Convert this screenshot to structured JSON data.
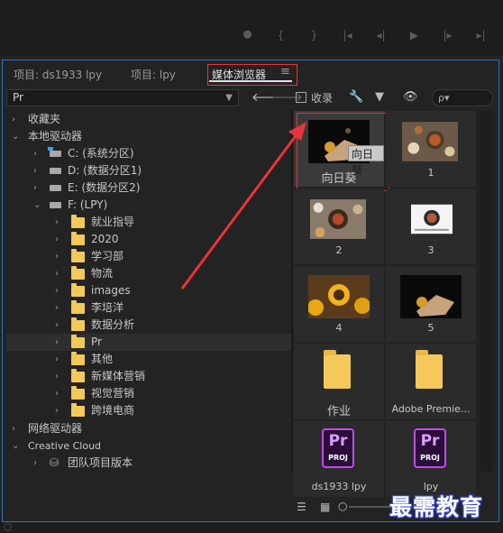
{
  "tabs": [
    {
      "label": "项目: ds1933 lpy"
    },
    {
      "label": "项目: lpy"
    },
    {
      "label": "媒体浏览器"
    }
  ],
  "tab_menu_icon": "hamburger-icon",
  "toolbar": {
    "path_value": "Pr",
    "favorite_label": "收录",
    "search_placeholder": "ρ▾"
  },
  "tree": {
    "favorites": "收藏夹",
    "local_drives": "本地驱动器",
    "drives": [
      {
        "label": "C: (系统分区)"
      },
      {
        "label": "D: (数据分区1)"
      },
      {
        "label": "E: (数据分区2)"
      },
      {
        "label": "F: (LPY)"
      }
    ],
    "folders": [
      {
        "label": "就业指导"
      },
      {
        "label": "2020"
      },
      {
        "label": "学习部"
      },
      {
        "label": "物流"
      },
      {
        "label": "images"
      },
      {
        "label": "李培洋"
      },
      {
        "label": "数据分析"
      },
      {
        "label": "Pr"
      },
      {
        "label": "其他"
      },
      {
        "label": "新媒体营销"
      },
      {
        "label": "视觉营销"
      },
      {
        "label": "跨境电商"
      }
    ],
    "network_drives": "网络驱动器",
    "creative_cloud": "Creative Cloud",
    "team_projects": "团队项目版本"
  },
  "grid": {
    "items": [
      {
        "caption": "向日葵"
      },
      {
        "caption": "1"
      },
      {
        "caption": "2"
      },
      {
        "caption": "3"
      },
      {
        "caption": "4"
      },
      {
        "caption": "5"
      },
      {
        "caption": "作业"
      },
      {
        "caption": "Adobe Premie..."
      },
      {
        "caption": "ds1933 lpy"
      },
      {
        "caption": "lpy"
      }
    ],
    "tooltip": "向日葵",
    "pr_label": "Pr",
    "proj_label": "PROJ"
  },
  "watermark": "最需教育",
  "colors": {
    "accent_border": "#2e71c5",
    "highlight_red": "#e8343a",
    "folder_yellow": "#f4c95a",
    "premiere_purple": "#c04cf0"
  }
}
